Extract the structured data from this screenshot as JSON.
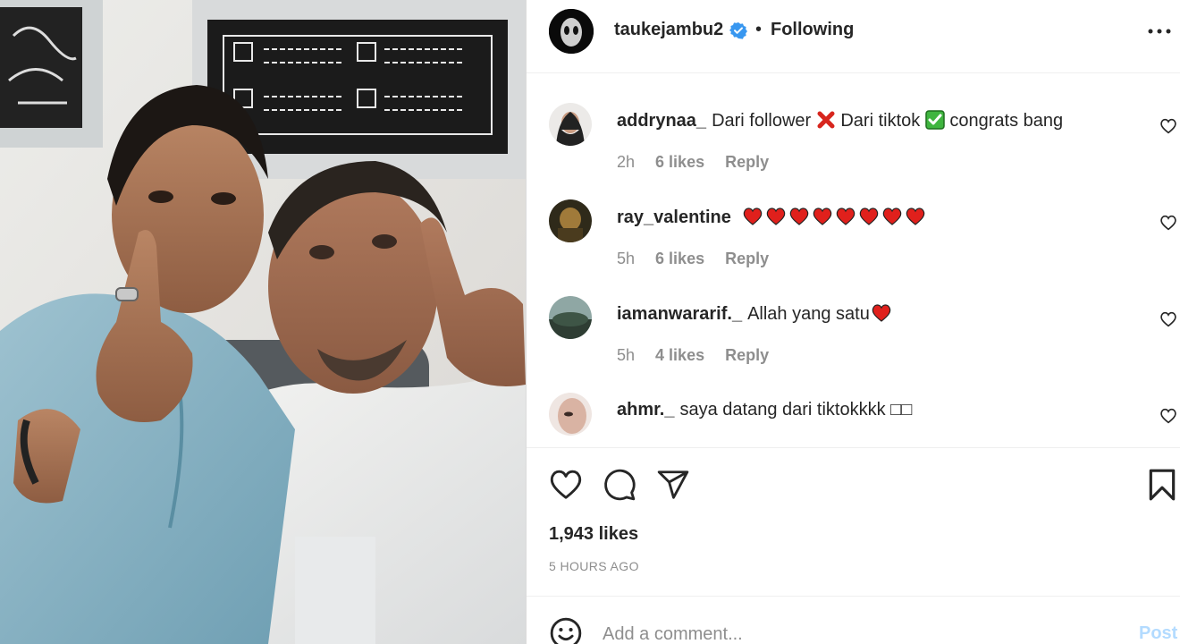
{
  "post": {
    "author": "taukejambu2",
    "follow_separator": "•",
    "follow_status": "Following",
    "likes": "1,943 likes",
    "time_ago": "5 HOURS AGO"
  },
  "comments": [
    {
      "username": "addrynaa_",
      "parts": [
        "Dari follower",
        "Dari tiktok",
        "congrats bang"
      ],
      "emojis": [
        "cross-mark",
        "check-mark"
      ],
      "time": "2h",
      "likes": "6 likes",
      "reply": "Reply"
    },
    {
      "username": "ray_valentine",
      "text": "",
      "emojis": [
        "red-heart",
        "red-heart",
        "red-heart",
        "red-heart",
        "red-heart",
        "red-heart",
        "red-heart",
        "red-heart"
      ],
      "time": "5h",
      "likes": "6 likes",
      "reply": "Reply"
    },
    {
      "username": "iamanwararif._",
      "text": "Allah yang satu",
      "emojis": [
        "red-heart"
      ],
      "time": "5h",
      "likes": "4 likes",
      "reply": "Reply"
    },
    {
      "username": "ahmr._",
      "text": "saya datang dari tiktokkkk □□",
      "time": "",
      "likes": "",
      "reply": ""
    }
  ],
  "add_comment": {
    "placeholder": "Add a comment...",
    "post_label": "Post"
  },
  "colors": {
    "verified": "#3897f0",
    "muted": "#8e8e8e",
    "post_disabled": "#b3dbff",
    "heart_red": "#e0201c"
  }
}
